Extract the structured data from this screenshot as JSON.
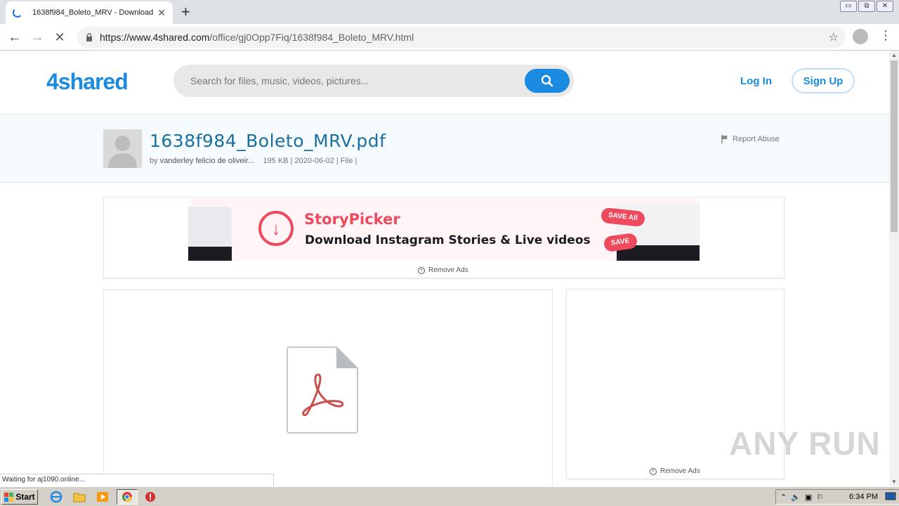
{
  "browser": {
    "tab_title": "1638f984_Boleto_MRV - Download -",
    "tab_close": "✕",
    "new_tab": "+",
    "url_host": "https://www.4shared.com",
    "url_path": "/office/gj0Opp7Fiq/1638f984_Boleto_MRV.html",
    "nav": {
      "back": "←",
      "forward": "→",
      "stop": "✕"
    },
    "bookmark": "☆",
    "menu": "⋮",
    "window_controls": [
      "▭",
      "⧉",
      "✕"
    ]
  },
  "site": {
    "logo": "4shared",
    "search_placeholder": "Search for files, music, videos, pictures...",
    "login": "Log In",
    "signup": "Sign Up"
  },
  "file": {
    "name": "1638f984_Boleto_MRV.pdf",
    "by_prefix": "by",
    "author": "vanderley felicio de oliveir...",
    "details": "195 KB | 2020-06-02 | File |",
    "report": "Report Abuse"
  },
  "ad": {
    "brand": "StoryPicker",
    "tagline": "Download Instagram Stories & Live videos",
    "pill_save_all": "SAVE All",
    "pill_save": "SAVE",
    "remove_ads": "Remove Ads"
  },
  "sidebar_ad": {
    "remove_ads": "Remove Ads"
  },
  "status_bar": "Waiting for aj1090.online...",
  "watermark": "ANY RUN",
  "taskbar": {
    "start": "Start",
    "clock": "6:34 PM"
  },
  "colors": {
    "brand_blue": "#1a8be0",
    "filename_blue": "#1a6fa0",
    "ad_red": "#ee4a5e",
    "pdf_red": "#c9514d"
  }
}
